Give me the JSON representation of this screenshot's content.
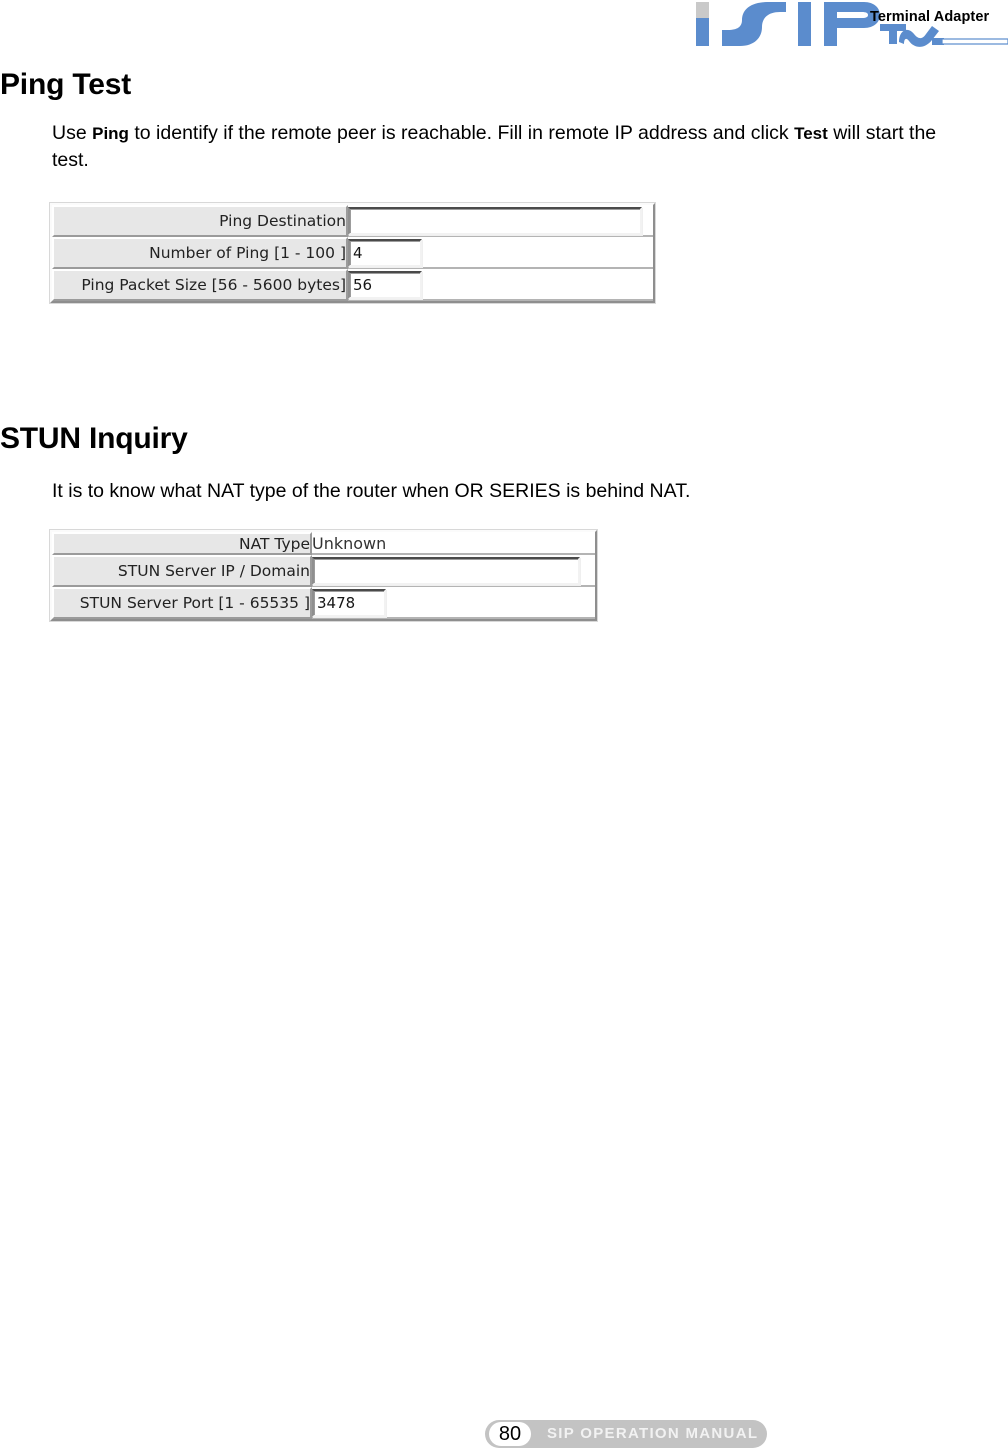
{
  "header": {
    "logo_text": "SIP",
    "logo_sub": "TA",
    "product_label": "Terminal Adapter",
    "accent_color": "#5b8ccd"
  },
  "sections": [
    {
      "title": "Ping Test",
      "paragraph_parts": [
        "Use ",
        "Ping",
        " to identify if the remote peer is reachable. Fill in remote IP address and click ",
        "Test",
        " will start the test."
      ],
      "form": {
        "rows": [
          {
            "label": "Ping Destination",
            "type": "input",
            "value": "",
            "size": "long"
          },
          {
            "label": "Number of Ping [1 - 100 ]",
            "type": "input",
            "value": "4",
            "size": "short"
          },
          {
            "label": "Ping Packet Size [56 - 5600 bytes]",
            "type": "input",
            "value": "56",
            "size": "short"
          }
        ]
      }
    },
    {
      "title": "STUN Inquiry",
      "paragraph_parts": [
        "It is to know what NAT type of the router when OR SERIES is behind NAT.",
        "",
        "",
        "",
        ""
      ],
      "form": {
        "rows": [
          {
            "label": "NAT Type",
            "type": "static",
            "value": "Unknown",
            "size": ""
          },
          {
            "label": "STUN Server IP / Domain",
            "type": "input",
            "value": "",
            "size": "long"
          },
          {
            "label": "STUN Server Port [1 - 65535 ]",
            "type": "input",
            "value": "3478",
            "size": "short"
          }
        ]
      }
    }
  ],
  "footer": {
    "page_number": "80",
    "manual_title": "SIP OPERATION MANUAL"
  }
}
